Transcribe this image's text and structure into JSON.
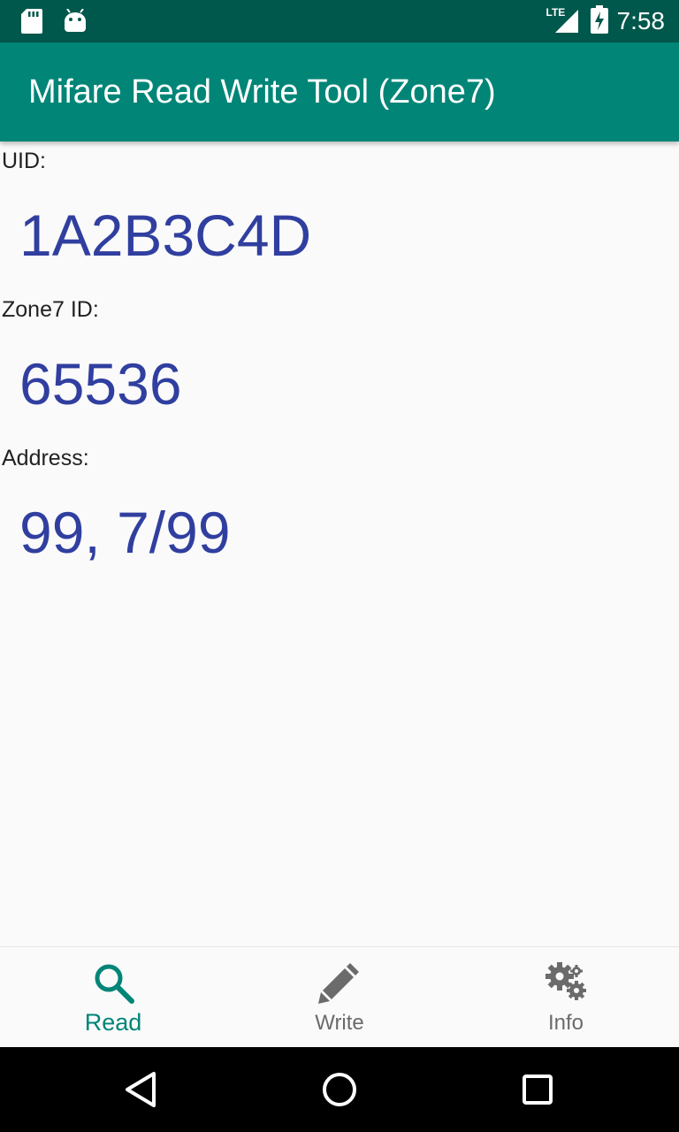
{
  "status_bar": {
    "network_label": "LTE",
    "time": "7:58",
    "icons": [
      "sd-card-icon",
      "android-icon",
      "lte-signal-icon",
      "battery-charging-icon"
    ]
  },
  "app_bar": {
    "title": "Mifare Read Write Tool (Zone7)",
    "color": "#008577"
  },
  "read": {
    "uid_label": "UID:",
    "uid_value": "1A2B3C4D",
    "zone7_label": "Zone7 ID:",
    "zone7_value": "65536",
    "address_label": "Address:",
    "address_value": "99, 7/99",
    "value_color": "#303f9f"
  },
  "bottom_nav": {
    "items": [
      {
        "label": "Read",
        "icon": "search-icon",
        "active": true
      },
      {
        "label": "Write",
        "icon": "pencil-icon",
        "active": false
      },
      {
        "label": "Info",
        "icon": "gears-icon",
        "active": false
      }
    ]
  },
  "system_nav": [
    "back-icon",
    "home-icon",
    "recents-icon"
  ]
}
